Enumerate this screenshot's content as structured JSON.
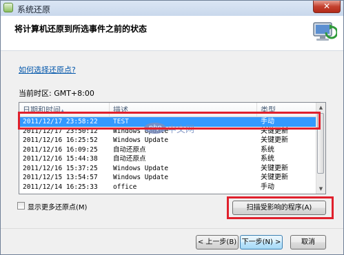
{
  "window": {
    "title": "系统还原",
    "close_label": "✕"
  },
  "header": {
    "heading": "将计算机还原到所选事件之前的状态"
  },
  "help_link": "如何选择还原点?",
  "timezone": "当前时区: GMT+8:00",
  "table": {
    "columns": [
      "日期和时间",
      "描述",
      "类型"
    ],
    "rows": [
      {
        "date": "2011/12/17 23:58:22",
        "desc": "TEST",
        "type": "手动",
        "selected": true
      },
      {
        "date": "2011/12/17 23:50:12",
        "desc": "Windows Update",
        "type": "关键更新"
      },
      {
        "date": "2011/12/16 16:25:52",
        "desc": "Windows Update",
        "type": "关键更新"
      },
      {
        "date": "2011/12/16 16:09:25",
        "desc": "自动还原点",
        "type": "系统"
      },
      {
        "date": "2011/12/16 15:44:38",
        "desc": "自动还原点",
        "type": "系统"
      },
      {
        "date": "2011/12/16 15:37:25",
        "desc": "Windows Update",
        "type": "关键更新"
      },
      {
        "date": "2011/12/15 13:54:57",
        "desc": "Windows Update",
        "type": "关键更新"
      },
      {
        "date": "2011/12/14 16:25:33",
        "desc": "office",
        "type": "手动"
      }
    ]
  },
  "show_more_label": "显示更多还原点(M)",
  "scan_button": "扫描受影响的程序(A)",
  "footer": {
    "back": "< 上一步(B)",
    "next": "下一步(N) >",
    "cancel": "取消"
  },
  "watermark": {
    "oval": "php",
    "text": "中文网"
  },
  "colors": {
    "selection": "#3399ff",
    "highlight_box": "#e0202c",
    "link": "#0055aa"
  }
}
